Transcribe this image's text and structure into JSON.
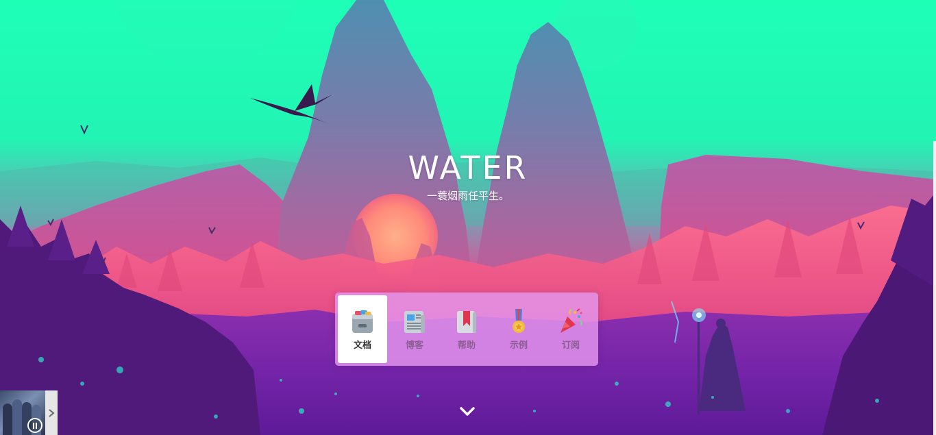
{
  "hero": {
    "title": "WATER",
    "subtitle": "一蓑烟雨任平生。"
  },
  "nav": {
    "items": [
      {
        "label": "文档",
        "icon": "card-file-box-icon",
        "active": true
      },
      {
        "label": "博客",
        "icon": "newspaper-icon",
        "active": false
      },
      {
        "label": "帮助",
        "icon": "bookmark-book-icon",
        "active": false
      },
      {
        "label": "示例",
        "icon": "medal-icon",
        "active": false
      },
      {
        "label": "订阅",
        "icon": "party-popper-icon",
        "active": false
      }
    ]
  },
  "scroll": {
    "icon": "chevron-down-icon"
  },
  "music_player": {
    "cover_icon": "album-cover",
    "play_icon": "pause-icon",
    "toggle_icon": "chevron-right-icon"
  },
  "colors": {
    "sky": "#1effb6",
    "mountain": "#6a86a8",
    "sun": "#ff8a7a",
    "forest_pink": "#ef4f86",
    "ground_purple": "#6a1fa0",
    "nav_card": "#e496ee",
    "nav_label": "#8b5e92"
  }
}
